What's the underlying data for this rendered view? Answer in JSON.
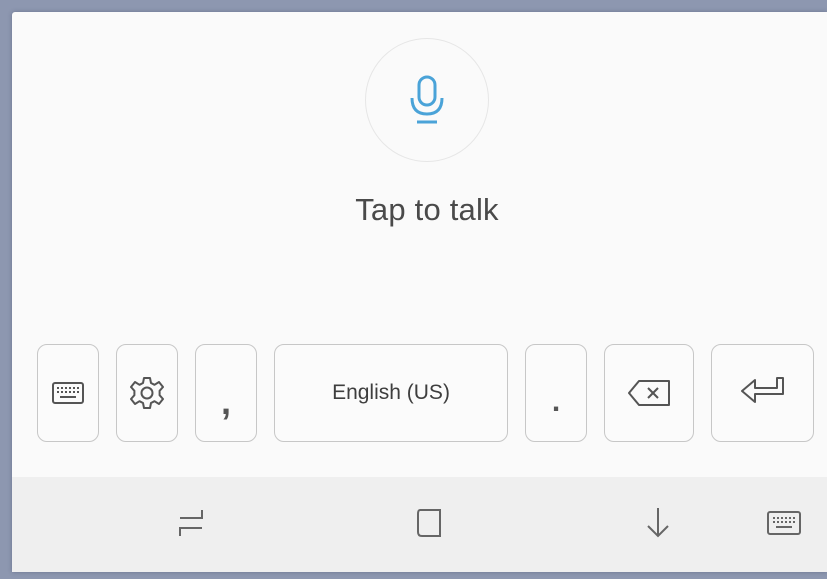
{
  "voice_panel": {
    "mic_icon": "microphone-icon",
    "prompt": "Tap to talk",
    "accent_color": "#4aa3d8"
  },
  "keyboard_row": {
    "keyboard_key_icon": "keyboard-icon",
    "settings_key_icon": "gear-icon",
    "comma": ",",
    "space_label": "English (US)",
    "period": ".",
    "backspace_icon": "backspace-icon",
    "enter_icon": "enter-icon"
  },
  "nav_bar": {
    "recents_icon": "recents-icon",
    "home_icon": "home-icon",
    "back_icon": "back-down-arrow-icon",
    "keyboard_switch_icon": "keyboard-icon"
  }
}
